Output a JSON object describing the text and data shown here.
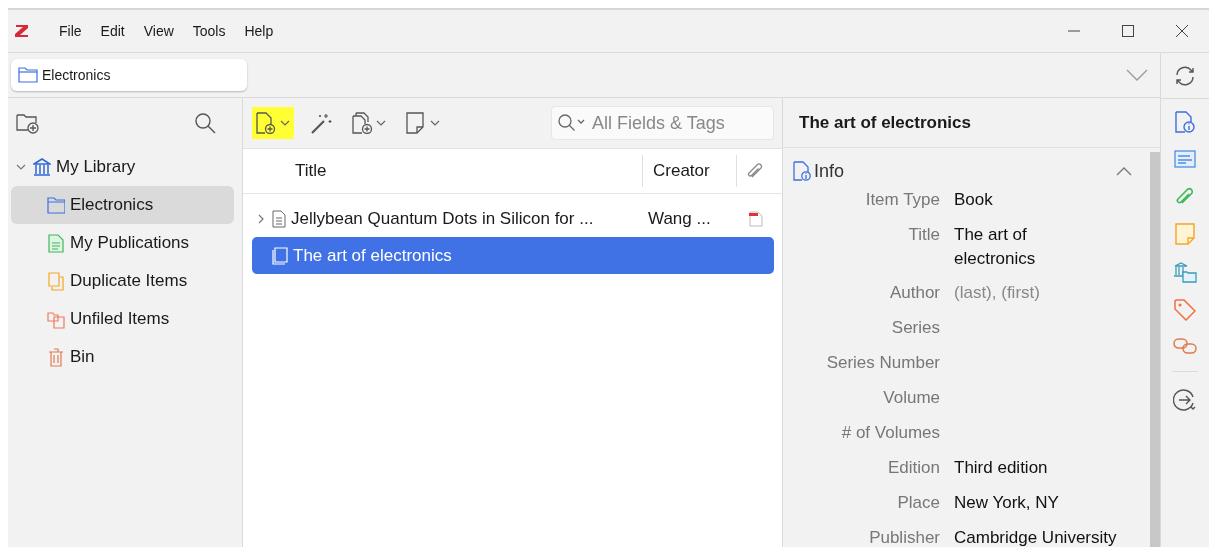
{
  "menu": [
    "File",
    "Edit",
    "View",
    "Tools",
    "Help"
  ],
  "tabs": [
    {
      "label": "Electronics",
      "selected": true
    }
  ],
  "collections": [
    {
      "label": "My Library",
      "kind": "library",
      "expanded": true,
      "selected": false,
      "children": [
        {
          "label": "Electronics",
          "kind": "folder",
          "selected": true
        },
        {
          "label": "My Publications",
          "kind": "publications",
          "selected": false
        },
        {
          "label": "Duplicate Items",
          "kind": "duplicates",
          "selected": false
        },
        {
          "label": "Unfiled Items",
          "kind": "unfiled",
          "selected": false
        },
        {
          "label": "Bin",
          "kind": "bin",
          "selected": false
        }
      ]
    }
  ],
  "toolbar": [
    {
      "kind": "new-item",
      "dropdown": true,
      "highlighted": true
    },
    {
      "kind": "wand",
      "dropdown": false,
      "highlighted": false
    },
    {
      "kind": "attachment",
      "dropdown": true,
      "highlighted": false
    },
    {
      "kind": "note",
      "dropdown": true,
      "highlighted": false
    }
  ],
  "search": {
    "placeholder": "All Fields & Tags"
  },
  "table": {
    "columns": [
      "Title",
      "Creator"
    ],
    "rows": [
      {
        "title": "Jellybean Quantum Dots in Silicon for ...",
        "creator": "Wang ...",
        "kind": "document",
        "expandable": true,
        "has_attachment": true,
        "selected": false
      },
      {
        "title": "The art of electronics",
        "kind": "book",
        "expandable": false,
        "has_attachment": false,
        "selected": true
      }
    ]
  },
  "item_pane": {
    "header": "The art of electronics",
    "section": "Info",
    "expanded": true,
    "fields": [
      {
        "label": "Item Type",
        "value": "Book",
        "kind": "text"
      },
      {
        "label": "Title",
        "value": "The art of electronics",
        "kind": "multiline"
      },
      {
        "label": "Author",
        "placeholder": "(last), (first)"
      },
      {
        "label": "Series"
      },
      {
        "label": "Series Number"
      },
      {
        "label": "Volume"
      },
      {
        "label": "# of Volumes"
      },
      {
        "label": "Edition",
        "value": "Third edition",
        "kind": "text"
      },
      {
        "label": "Place",
        "value": "New York, NY",
        "kind": "text"
      },
      {
        "label": "Publisher",
        "value": "Cambridge University",
        "kind": "text"
      }
    ]
  }
}
